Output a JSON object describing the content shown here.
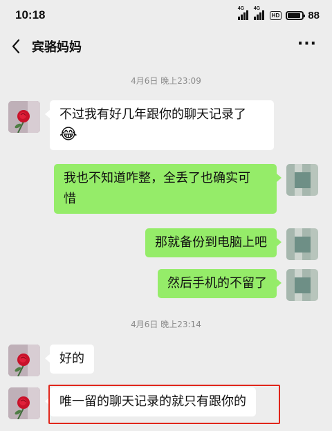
{
  "status_bar": {
    "time": "10:18",
    "signal_1_label": "4G",
    "signal_2_label": "4G",
    "hd_label": "HD",
    "battery_level": "88",
    "battery_fraction": 0.88
  },
  "nav": {
    "back_icon": "chevron-left-icon",
    "title": "宾骆妈妈",
    "more_icon": "more-dots-icon",
    "more_label": "···"
  },
  "messages": [
    {
      "type": "timestamp",
      "text": "4月6日 晚上23:09"
    },
    {
      "type": "received",
      "sender": "宾骆妈妈",
      "text": "不过我有好几年跟你的聊天记录了",
      "emoji": "😂"
    },
    {
      "type": "sent",
      "text_line1": "我也不知道咋整，全丢了也确实可",
      "text_line2": "惜"
    },
    {
      "type": "sent",
      "text": "那就备份到电脑上吧"
    },
    {
      "type": "sent",
      "text": "然后手机的不留了"
    },
    {
      "type": "timestamp",
      "text": "4月6日 晚上23:14"
    },
    {
      "type": "received",
      "text": "好的"
    },
    {
      "type": "received",
      "text": "唯一留的聊天记录的就只有跟你的",
      "highlighted": true
    }
  ],
  "colors": {
    "background": "#ededed",
    "sent_bubble": "#95ec69",
    "received_bubble": "#ffffff",
    "highlight_border": "#e0261b"
  }
}
